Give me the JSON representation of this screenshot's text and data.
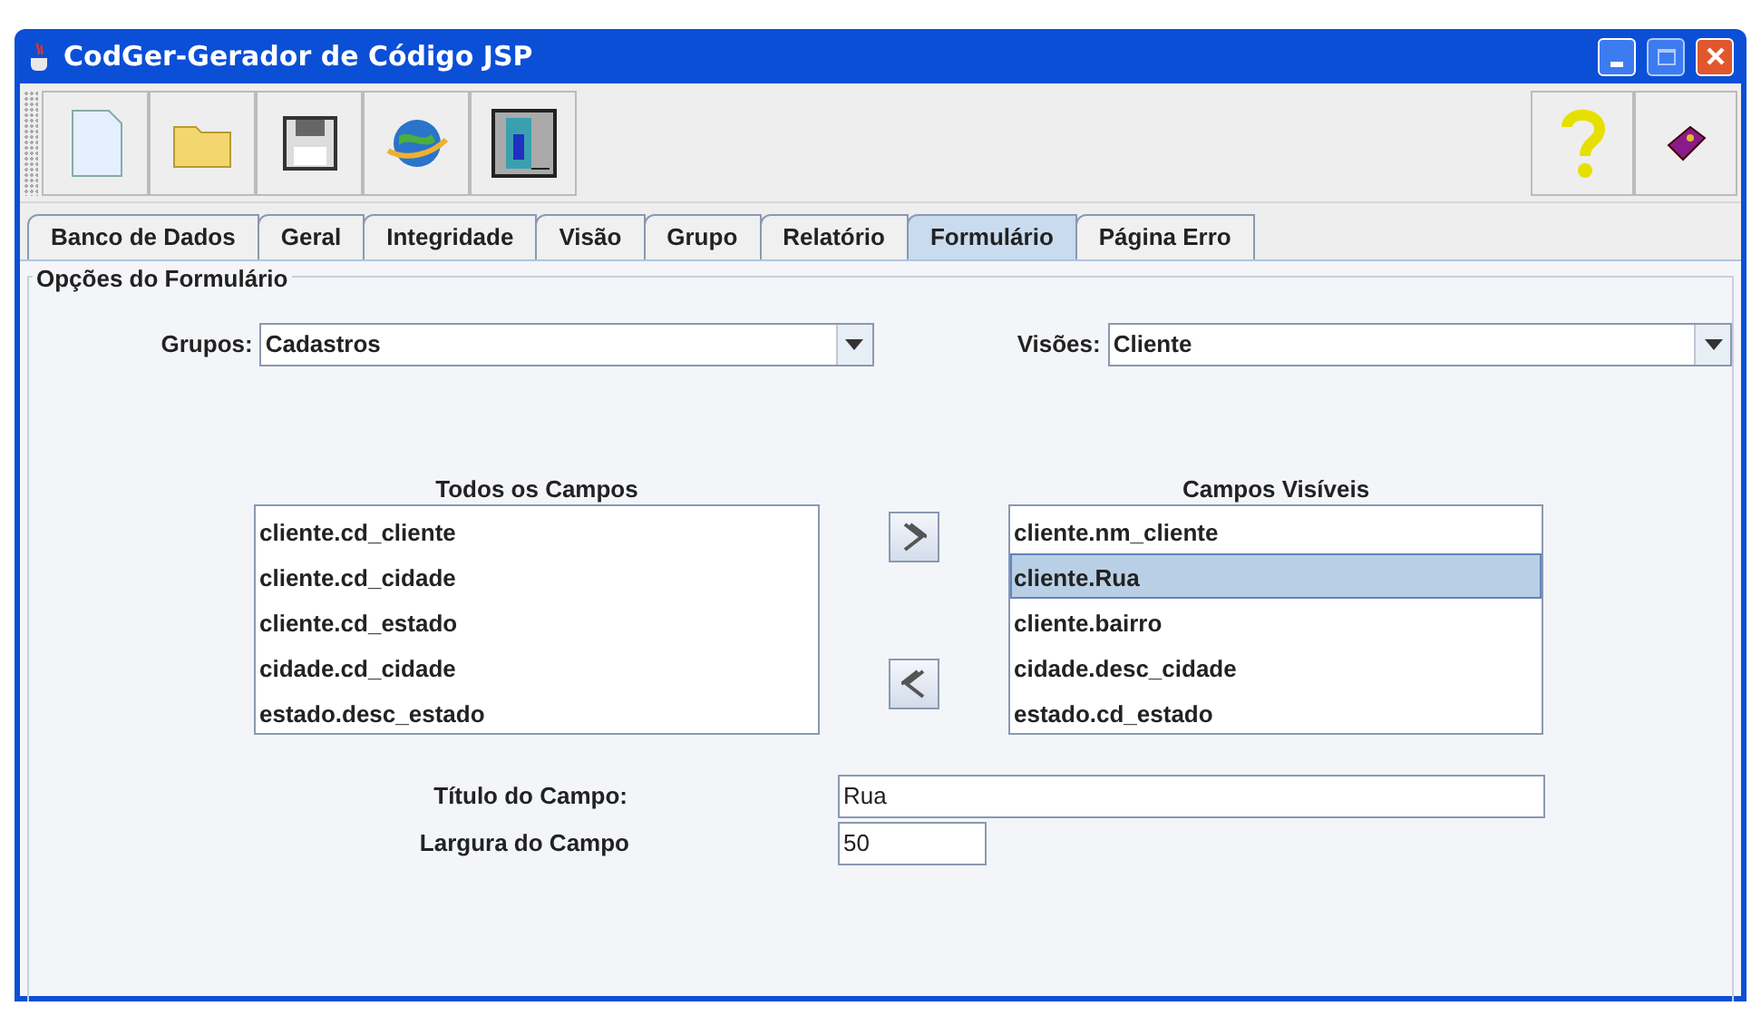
{
  "window": {
    "title": "CodGer-Gerador de Código JSP"
  },
  "tabs": [
    {
      "label": "Banco de Dados",
      "selected": false
    },
    {
      "label": "Geral",
      "selected": false
    },
    {
      "label": "Integridade",
      "selected": false
    },
    {
      "label": "Visão",
      "selected": false
    },
    {
      "label": "Grupo",
      "selected": false
    },
    {
      "label": "Relatório",
      "selected": false
    },
    {
      "label": "Formulário",
      "selected": true
    },
    {
      "label": "Página Erro",
      "selected": false
    }
  ],
  "panel": {
    "title": "Opções do Formulário",
    "grupos": {
      "label": "Grupos:",
      "value": "Cadastros"
    },
    "visoes": {
      "label": "Visões:",
      "value": "Cliente"
    },
    "all_fields": {
      "title": "Todos os Campos",
      "items": [
        {
          "label": "cliente.cd_cliente",
          "selected": false
        },
        {
          "label": "cliente.cd_cidade",
          "selected": false
        },
        {
          "label": "cliente.cd_estado",
          "selected": false
        },
        {
          "label": "cidade.cd_cidade",
          "selected": false
        },
        {
          "label": "estado.desc_estado",
          "selected": false
        }
      ]
    },
    "visible_fields": {
      "title": "Campos Visíveis",
      "items": [
        {
          "label": "cliente.nm_cliente",
          "selected": false
        },
        {
          "label": "cliente.Rua",
          "selected": true
        },
        {
          "label": "cliente.bairro",
          "selected": false
        },
        {
          "label": "cidade.desc_cidade",
          "selected": false
        },
        {
          "label": "estado.cd_estado",
          "selected": false
        }
      ]
    },
    "field_title": {
      "label": "Título do Campo:",
      "value": "Rua"
    },
    "field_width": {
      "label": "Largura do Campo",
      "value": "50"
    }
  }
}
